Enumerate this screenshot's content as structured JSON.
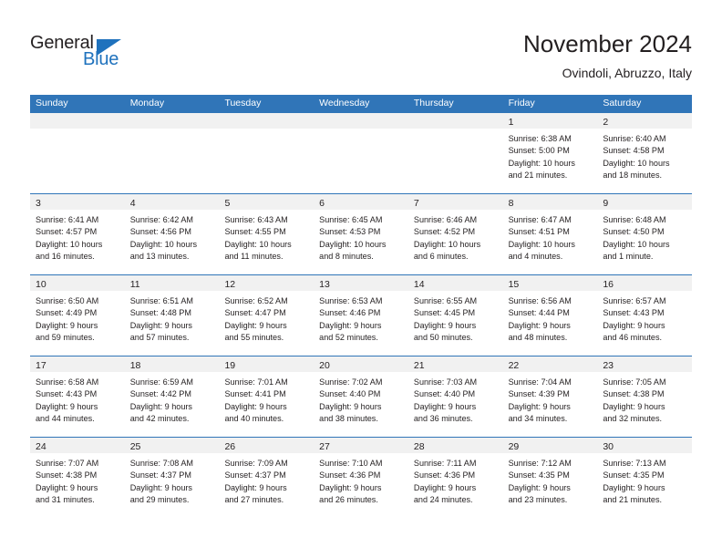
{
  "brand": {
    "name_dark": "General",
    "name_blue": "Blue",
    "triangle_color": "#1f72bd"
  },
  "header": {
    "title": "November 2024",
    "subtitle": "Ovindoli, Abruzzo, Italy"
  },
  "colors": {
    "header_blue": "#3075b8",
    "day_strip_gray": "#f1f1f1",
    "text": "#231f20",
    "brand_blue": "#1f72bd"
  },
  "weekday_headers": [
    "Sunday",
    "Monday",
    "Tuesday",
    "Wednesday",
    "Thursday",
    "Friday",
    "Saturday"
  ],
  "weeks": [
    {
      "days": [
        {
          "number": "",
          "sunrise": "",
          "sunset": "",
          "daylight_1": "",
          "daylight_2": "",
          "empty": true
        },
        {
          "number": "",
          "sunrise": "",
          "sunset": "",
          "daylight_1": "",
          "daylight_2": "",
          "empty": true
        },
        {
          "number": "",
          "sunrise": "",
          "sunset": "",
          "daylight_1": "",
          "daylight_2": "",
          "empty": true
        },
        {
          "number": "",
          "sunrise": "",
          "sunset": "",
          "daylight_1": "",
          "daylight_2": "",
          "empty": true
        },
        {
          "number": "",
          "sunrise": "",
          "sunset": "",
          "daylight_1": "",
          "daylight_2": "",
          "empty": true
        },
        {
          "number": "1",
          "sunrise": "Sunrise: 6:38 AM",
          "sunset": "Sunset: 5:00 PM",
          "daylight_1": "Daylight: 10 hours",
          "daylight_2": "and 21 minutes.",
          "empty": false
        },
        {
          "number": "2",
          "sunrise": "Sunrise: 6:40 AM",
          "sunset": "Sunset: 4:58 PM",
          "daylight_1": "Daylight: 10 hours",
          "daylight_2": "and 18 minutes.",
          "empty": false
        }
      ]
    },
    {
      "days": [
        {
          "number": "3",
          "sunrise": "Sunrise: 6:41 AM",
          "sunset": "Sunset: 4:57 PM",
          "daylight_1": "Daylight: 10 hours",
          "daylight_2": "and 16 minutes.",
          "empty": false
        },
        {
          "number": "4",
          "sunrise": "Sunrise: 6:42 AM",
          "sunset": "Sunset: 4:56 PM",
          "daylight_1": "Daylight: 10 hours",
          "daylight_2": "and 13 minutes.",
          "empty": false
        },
        {
          "number": "5",
          "sunrise": "Sunrise: 6:43 AM",
          "sunset": "Sunset: 4:55 PM",
          "daylight_1": "Daylight: 10 hours",
          "daylight_2": "and 11 minutes.",
          "empty": false
        },
        {
          "number": "6",
          "sunrise": "Sunrise: 6:45 AM",
          "sunset": "Sunset: 4:53 PM",
          "daylight_1": "Daylight: 10 hours",
          "daylight_2": "and 8 minutes.",
          "empty": false
        },
        {
          "number": "7",
          "sunrise": "Sunrise: 6:46 AM",
          "sunset": "Sunset: 4:52 PM",
          "daylight_1": "Daylight: 10 hours",
          "daylight_2": "and 6 minutes.",
          "empty": false
        },
        {
          "number": "8",
          "sunrise": "Sunrise: 6:47 AM",
          "sunset": "Sunset: 4:51 PM",
          "daylight_1": "Daylight: 10 hours",
          "daylight_2": "and 4 minutes.",
          "empty": false
        },
        {
          "number": "9",
          "sunrise": "Sunrise: 6:48 AM",
          "sunset": "Sunset: 4:50 PM",
          "daylight_1": "Daylight: 10 hours",
          "daylight_2": "and 1 minute.",
          "empty": false
        }
      ]
    },
    {
      "days": [
        {
          "number": "10",
          "sunrise": "Sunrise: 6:50 AM",
          "sunset": "Sunset: 4:49 PM",
          "daylight_1": "Daylight: 9 hours",
          "daylight_2": "and 59 minutes.",
          "empty": false
        },
        {
          "number": "11",
          "sunrise": "Sunrise: 6:51 AM",
          "sunset": "Sunset: 4:48 PM",
          "daylight_1": "Daylight: 9 hours",
          "daylight_2": "and 57 minutes.",
          "empty": false
        },
        {
          "number": "12",
          "sunrise": "Sunrise: 6:52 AM",
          "sunset": "Sunset: 4:47 PM",
          "daylight_1": "Daylight: 9 hours",
          "daylight_2": "and 55 minutes.",
          "empty": false
        },
        {
          "number": "13",
          "sunrise": "Sunrise: 6:53 AM",
          "sunset": "Sunset: 4:46 PM",
          "daylight_1": "Daylight: 9 hours",
          "daylight_2": "and 52 minutes.",
          "empty": false
        },
        {
          "number": "14",
          "sunrise": "Sunrise: 6:55 AM",
          "sunset": "Sunset: 4:45 PM",
          "daylight_1": "Daylight: 9 hours",
          "daylight_2": "and 50 minutes.",
          "empty": false
        },
        {
          "number": "15",
          "sunrise": "Sunrise: 6:56 AM",
          "sunset": "Sunset: 4:44 PM",
          "daylight_1": "Daylight: 9 hours",
          "daylight_2": "and 48 minutes.",
          "empty": false
        },
        {
          "number": "16",
          "sunrise": "Sunrise: 6:57 AM",
          "sunset": "Sunset: 4:43 PM",
          "daylight_1": "Daylight: 9 hours",
          "daylight_2": "and 46 minutes.",
          "empty": false
        }
      ]
    },
    {
      "days": [
        {
          "number": "17",
          "sunrise": "Sunrise: 6:58 AM",
          "sunset": "Sunset: 4:43 PM",
          "daylight_1": "Daylight: 9 hours",
          "daylight_2": "and 44 minutes.",
          "empty": false
        },
        {
          "number": "18",
          "sunrise": "Sunrise: 6:59 AM",
          "sunset": "Sunset: 4:42 PM",
          "daylight_1": "Daylight: 9 hours",
          "daylight_2": "and 42 minutes.",
          "empty": false
        },
        {
          "number": "19",
          "sunrise": "Sunrise: 7:01 AM",
          "sunset": "Sunset: 4:41 PM",
          "daylight_1": "Daylight: 9 hours",
          "daylight_2": "and 40 minutes.",
          "empty": false
        },
        {
          "number": "20",
          "sunrise": "Sunrise: 7:02 AM",
          "sunset": "Sunset: 4:40 PM",
          "daylight_1": "Daylight: 9 hours",
          "daylight_2": "and 38 minutes.",
          "empty": false
        },
        {
          "number": "21",
          "sunrise": "Sunrise: 7:03 AM",
          "sunset": "Sunset: 4:40 PM",
          "daylight_1": "Daylight: 9 hours",
          "daylight_2": "and 36 minutes.",
          "empty": false
        },
        {
          "number": "22",
          "sunrise": "Sunrise: 7:04 AM",
          "sunset": "Sunset: 4:39 PM",
          "daylight_1": "Daylight: 9 hours",
          "daylight_2": "and 34 minutes.",
          "empty": false
        },
        {
          "number": "23",
          "sunrise": "Sunrise: 7:05 AM",
          "sunset": "Sunset: 4:38 PM",
          "daylight_1": "Daylight: 9 hours",
          "daylight_2": "and 32 minutes.",
          "empty": false
        }
      ]
    },
    {
      "days": [
        {
          "number": "24",
          "sunrise": "Sunrise: 7:07 AM",
          "sunset": "Sunset: 4:38 PM",
          "daylight_1": "Daylight: 9 hours",
          "daylight_2": "and 31 minutes.",
          "empty": false
        },
        {
          "number": "25",
          "sunrise": "Sunrise: 7:08 AM",
          "sunset": "Sunset: 4:37 PM",
          "daylight_1": "Daylight: 9 hours",
          "daylight_2": "and 29 minutes.",
          "empty": false
        },
        {
          "number": "26",
          "sunrise": "Sunrise: 7:09 AM",
          "sunset": "Sunset: 4:37 PM",
          "daylight_1": "Daylight: 9 hours",
          "daylight_2": "and 27 minutes.",
          "empty": false
        },
        {
          "number": "27",
          "sunrise": "Sunrise: 7:10 AM",
          "sunset": "Sunset: 4:36 PM",
          "daylight_1": "Daylight: 9 hours",
          "daylight_2": "and 26 minutes.",
          "empty": false
        },
        {
          "number": "28",
          "sunrise": "Sunrise: 7:11 AM",
          "sunset": "Sunset: 4:36 PM",
          "daylight_1": "Daylight: 9 hours",
          "daylight_2": "and 24 minutes.",
          "empty": false
        },
        {
          "number": "29",
          "sunrise": "Sunrise: 7:12 AM",
          "sunset": "Sunset: 4:35 PM",
          "daylight_1": "Daylight: 9 hours",
          "daylight_2": "and 23 minutes.",
          "empty": false
        },
        {
          "number": "30",
          "sunrise": "Sunrise: 7:13 AM",
          "sunset": "Sunset: 4:35 PM",
          "daylight_1": "Daylight: 9 hours",
          "daylight_2": "and 21 minutes.",
          "empty": false
        }
      ]
    }
  ]
}
